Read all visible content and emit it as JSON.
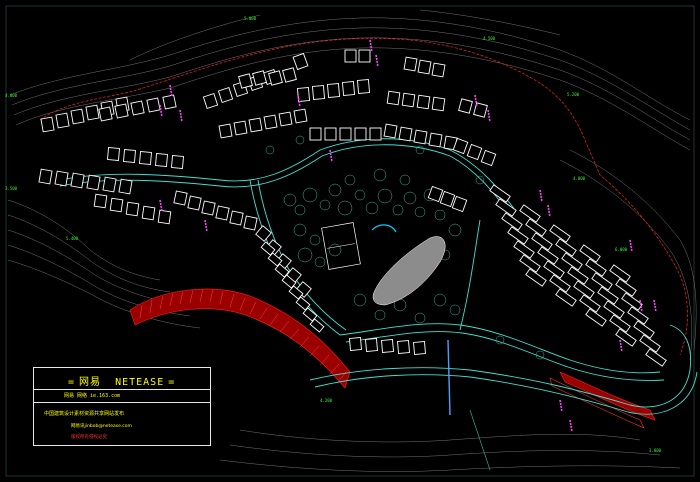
{
  "drawing": {
    "background": "#000000",
    "colors": {
      "contour": "#9a9a9a",
      "boundary": "#ff2020",
      "road": "#40e0d0",
      "building": "#ffffff",
      "vegetation": "#30c0a0",
      "elevation_label": "#30ff30",
      "marker": "#ff40ff",
      "title_text": "#ffff00"
    }
  },
  "title_block": {
    "brand_cn": "网易",
    "brand_en": "NETEASE",
    "site_line": "网易 网络  ie.163.com",
    "line3": "中国建筑设计素材资源共享网站发布",
    "line4": "网易讯jinbob@netease.com",
    "line5": "版权所有侵权必究"
  },
  "elevation_labels": [
    "5.000",
    "4.500",
    "4.000",
    "3.500",
    "5.200",
    "4.800",
    "5.400",
    "3.800",
    "6.000",
    "4.200"
  ]
}
